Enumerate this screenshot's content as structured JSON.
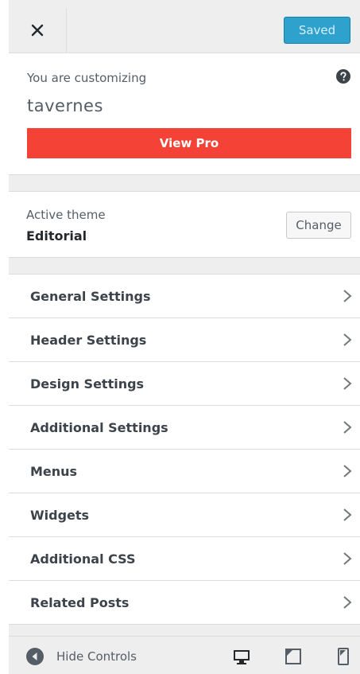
{
  "header": {
    "close_icon": "close-icon",
    "saved_label": "Saved"
  },
  "info": {
    "label": "You are customizing",
    "site_name": "tavernes",
    "help_icon": "help-circle-icon",
    "view_pro_label": "View Pro"
  },
  "theme": {
    "label": "Active theme",
    "name": "Editorial",
    "change_label": "Change"
  },
  "menu": {
    "items": [
      {
        "label": "General Settings"
      },
      {
        "label": "Header Settings"
      },
      {
        "label": "Design Settings"
      },
      {
        "label": "Additional Settings"
      },
      {
        "label": "Menus"
      },
      {
        "label": "Widgets"
      },
      {
        "label": "Additional CSS"
      },
      {
        "label": "Related Posts"
      }
    ]
  },
  "footer": {
    "hide_controls_label": "Hide Controls",
    "devices": [
      "desktop-icon",
      "tablet-icon",
      "mobile-icon"
    ]
  },
  "colors": {
    "accent": "#2ea2cc",
    "view_pro": "#f44336",
    "panel_bg": "#eeeeee"
  }
}
